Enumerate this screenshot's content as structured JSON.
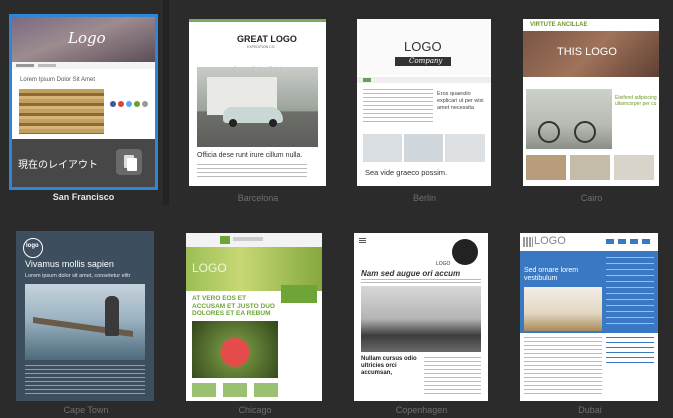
{
  "templates": [
    {
      "name": "San Francisco",
      "logo": "Logo",
      "headline": "Lorem Ipsum Dolor Sit Amet",
      "current_label": "現在のレイアウト",
      "active": true
    },
    {
      "name": "Barcelona",
      "logo": "GREAT LOGO",
      "logo_sub": "EXPEDITION CO",
      "nav": [
        "Home",
        "About",
        "Contact"
      ],
      "headline": "Officia dese runt irure cillum nulla."
    },
    {
      "name": "Berlin",
      "logo": "LOGO",
      "logo_sub": "Company",
      "side_text": "Eros quaestio explicari ut per wisi amet necessita",
      "headline": "Sea vide graeco possim."
    },
    {
      "name": "Cairo",
      "logo": "VIRTUTE ANCILLAE",
      "hero_logo": "THIS LOGO",
      "headline": "Eleifend adipiscing ullamcorper per cu"
    },
    {
      "name": "Cape Town",
      "logo": "logo",
      "headline": "Vivamus mollis sapien",
      "subhead": "Lorem ipsum dolor sit amet, consetetur elitr"
    },
    {
      "name": "Chicago",
      "logo": "LOGO",
      "headline": "AT VERO EOS ET ACCUSAM ET JUSTO DUO DOLORES ET EA REBUM"
    },
    {
      "name": "Copenhagen",
      "logo": "LOGO",
      "headline": "Nam sed augue ori accum",
      "body_title": "Nullam cursus odio ultricies orci accumsan,"
    },
    {
      "name": "Dubai",
      "logo": "LOGO",
      "headline": "Sed ornare lorem vestibulum"
    }
  ],
  "colors": {
    "background": "#2b2b2b",
    "selection": "#2f86d9",
    "chicago_green": "#6ea536",
    "dubai_blue": "#3b78c4",
    "cairo_green": "#6c9a2e"
  }
}
